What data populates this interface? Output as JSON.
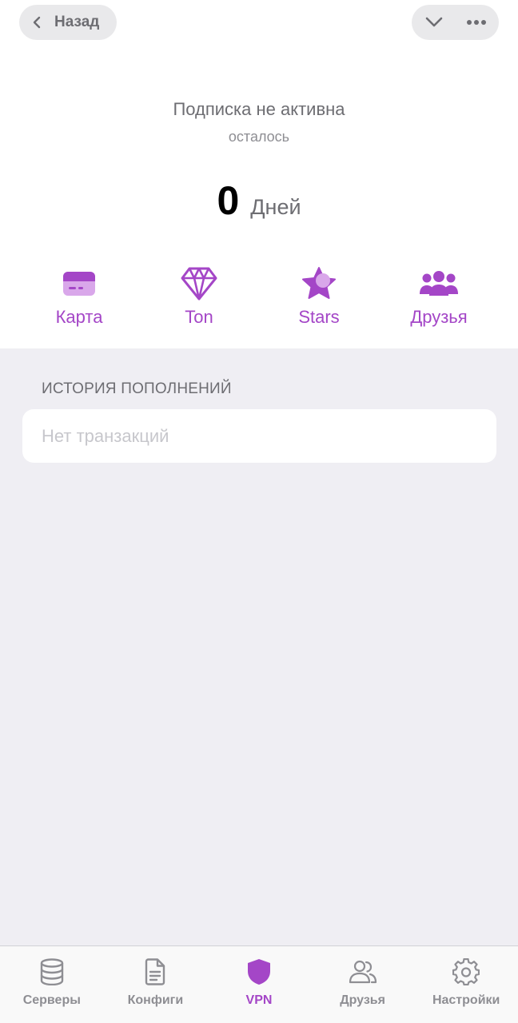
{
  "header": {
    "back_label": "Назад"
  },
  "subscription": {
    "status": "Подписка не активна",
    "remaining_label": "осталось",
    "days_value": "0",
    "days_unit": "Дней"
  },
  "payment_methods": [
    {
      "label": "Карта",
      "icon": "credit-card-icon"
    },
    {
      "label": "Ton",
      "icon": "diamond-icon"
    },
    {
      "label": "Stars",
      "icon": "star-icon"
    },
    {
      "label": "Друзья",
      "icon": "friends-icon"
    }
  ],
  "history": {
    "title": "ИСТОРИЯ ПОПОЛНЕНИЙ",
    "empty_text": "Нет транзакций"
  },
  "tabbar": {
    "active": "VPN",
    "items": [
      {
        "label": "Серверы",
        "icon": "database-icon"
      },
      {
        "label": "Конфиги",
        "icon": "document-icon"
      },
      {
        "label": "VPN",
        "icon": "shield-icon"
      },
      {
        "label": "Друзья",
        "icon": "users-icon"
      },
      {
        "label": "Настройки",
        "icon": "gear-icon"
      }
    ]
  },
  "colors": {
    "accent": "#a446c7",
    "accent_light": "#d9a7ea",
    "background": "#efeef3",
    "secondary_text": "#6d6d72"
  }
}
